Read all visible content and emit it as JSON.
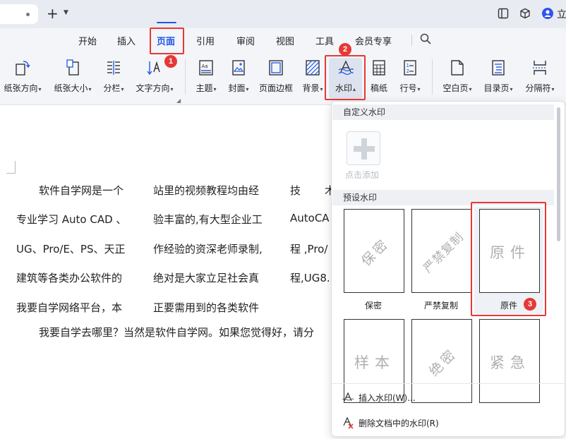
{
  "titlebar": {
    "new_tab_glyph": "+",
    "user_name": "立"
  },
  "menu": {
    "tabs": [
      "开始",
      "插入",
      "页面",
      "引用",
      "审阅",
      "视图",
      "工具",
      "会员专享"
    ],
    "active_tab": "页面"
  },
  "ribbon": {
    "buttons": [
      {
        "label": "纸张方向",
        "icon": "orientation-icon"
      },
      {
        "label": "纸张大小",
        "icon": "paper-size-icon"
      },
      {
        "label": "分栏",
        "icon": "columns-icon"
      },
      {
        "label": "文字方向",
        "icon": "text-direction-icon"
      },
      {
        "label": "主题",
        "icon": "theme-icon"
      },
      {
        "label": "封面",
        "icon": "cover-icon"
      },
      {
        "label": "页面边框",
        "icon": "page-border-icon"
      },
      {
        "label": "背景",
        "icon": "background-icon"
      },
      {
        "label": "水印",
        "icon": "watermark-icon"
      },
      {
        "label": "稿纸",
        "icon": "draft-paper-icon"
      },
      {
        "label": "行号",
        "icon": "line-number-icon"
      },
      {
        "label": "空白页",
        "icon": "blank-page-icon"
      },
      {
        "label": "目录页",
        "icon": "toc-page-icon"
      },
      {
        "label": "分隔符",
        "icon": "separator-icon"
      }
    ]
  },
  "document": {
    "lines": [
      {
        "a": "软件自学网是一个",
        "b": "站里的视频教程均由经",
        "c": "技",
        "d": "术"
      },
      {
        "a": "专业学习 Auto CAD 、",
        "b": "验丰富的,有大型企业工",
        "c": "AutoCA"
      },
      {
        "a": "UG、Pro/E、PS、天正",
        "b": "作经验的资深老师录制,",
        "c": "程 ,Pro/"
      },
      {
        "a": "建筑等各类办公软件的",
        "b": "绝对是大家立足社会真",
        "c": "程,UG8."
      },
      {
        "a": "我要自学网络平台，本",
        "b": "正要需用到的各类软件"
      }
    ],
    "last_line": "我要自学去哪里？当然是软件自学网。如果您觉得好，请分"
  },
  "watermark_panel": {
    "custom_header": "自定义水印",
    "add_label": "点击添加",
    "preset_header": "预设水印",
    "presets": [
      {
        "text": "保密",
        "label": "保密"
      },
      {
        "text": "严禁复制",
        "label": "严禁复制"
      },
      {
        "text": "原件",
        "label": "原件"
      },
      {
        "text": "样本",
        "label": ""
      },
      {
        "text": "绝密",
        "label": ""
      },
      {
        "text": "紧急",
        "label": ""
      }
    ],
    "insert_action": "插入水印(W)...",
    "remove_action": "删除文档中的水印(R)"
  },
  "annotations": {
    "badges": [
      "1",
      "2",
      "3"
    ],
    "color": "#e53935"
  },
  "colors": {
    "accent": "#1f57e6",
    "highlight": "#e53935"
  }
}
